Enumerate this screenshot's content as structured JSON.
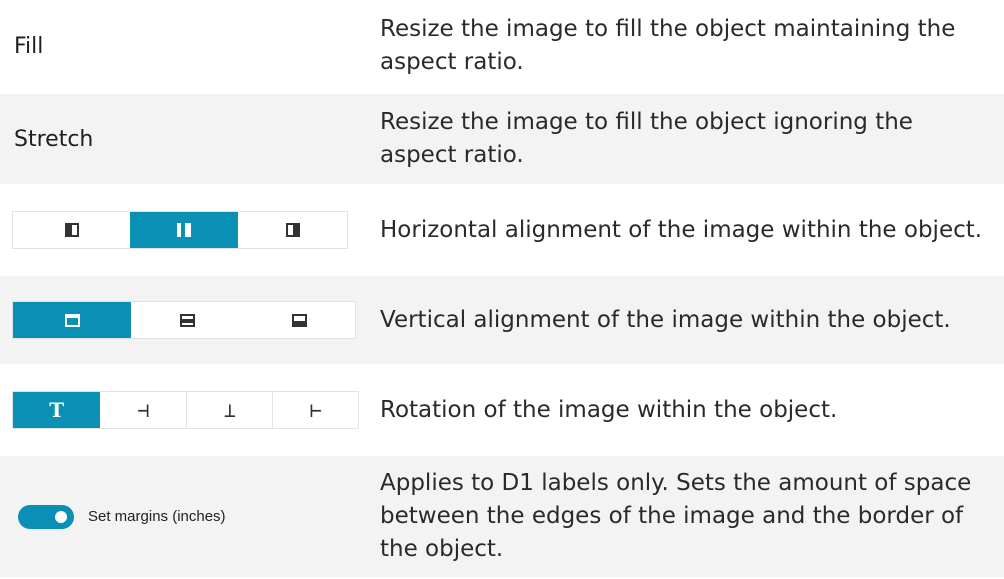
{
  "rows": [
    {
      "term": "Fill",
      "description": "Resize the image to fill the object maintaining the aspect ratio."
    },
    {
      "term": "Stretch",
      "description": "Resize the image to fill the object ignoring the aspect ratio."
    },
    {
      "description": "Horizontal alignment of the image within the object.",
      "selected": "center"
    },
    {
      "description": "Vertical alignment of the image within the object.",
      "selected": "top"
    },
    {
      "description": "Rotation of the image within the object.",
      "selected": "T"
    },
    {
      "description": "Applies to D1 labels only. Sets the amount of space between the edges of the image and the border of the object.",
      "toggle_label": "Set margins (inches)",
      "toggle_on": true
    }
  ],
  "rotation_glyphs": [
    "T",
    "⊣",
    "⊥",
    "⊢"
  ],
  "colors": {
    "accent": "#0a8fb5",
    "row_alt": "#f3f3f3"
  }
}
